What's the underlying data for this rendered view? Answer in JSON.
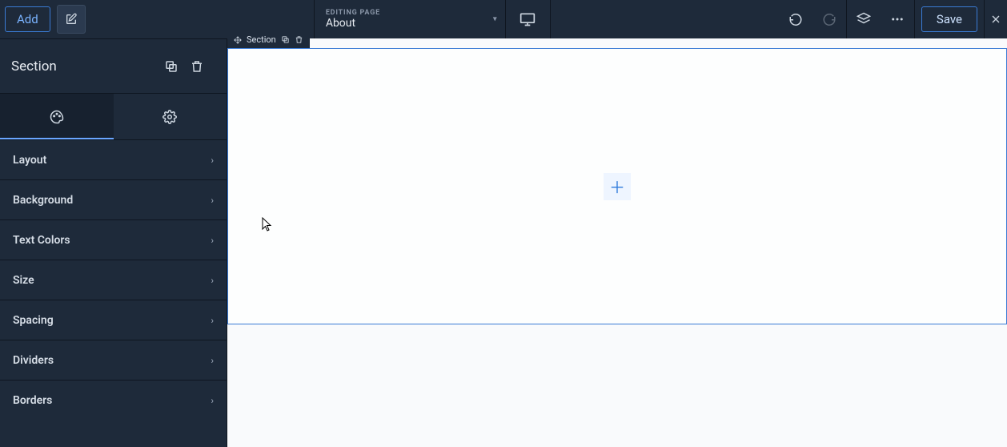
{
  "topbar": {
    "add_label": "Add",
    "page_selector": {
      "label": "EDITING PAGE",
      "value": "About"
    },
    "save_label": "Save"
  },
  "sidebar": {
    "title": "Section",
    "items": [
      {
        "label": "Layout"
      },
      {
        "label": "Background"
      },
      {
        "label": "Text Colors"
      },
      {
        "label": "Size"
      },
      {
        "label": "Spacing"
      },
      {
        "label": "Dividers"
      },
      {
        "label": "Borders"
      }
    ]
  },
  "canvas": {
    "section_tag_label": "Section"
  },
  "colors": {
    "accent": "#3a7bd5",
    "panel_bg": "#1e2a3a"
  }
}
